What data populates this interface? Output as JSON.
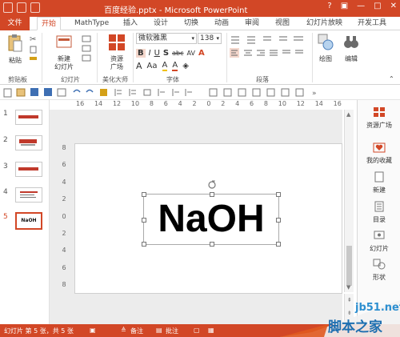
{
  "window": {
    "title": "百度经验.pptx - Microsoft PowerPoint",
    "controls": [
      "?",
      "▣",
      "—",
      "□",
      "✕"
    ]
  },
  "tabs": [
    "文件",
    "开始",
    "MathType",
    "插入",
    "设计",
    "切换",
    "动画",
    "审阅",
    "视图",
    "幻灯片放映",
    "开发工具"
  ],
  "ribbon": {
    "paste": "粘贴",
    "new_slide": "新建\n幻灯片",
    "resource_square": "资源\n广场",
    "font_name": "微软雅黑",
    "font_size": "138",
    "drawing": "绘图",
    "editing": "编辑",
    "groups": [
      "剪贴板",
      "幻灯片",
      "美化大师",
      "字体",
      "段落"
    ],
    "font_buttons": [
      "B",
      "I",
      "U",
      "S",
      "abc",
      "AV",
      "A"
    ],
    "font_row2": [
      "A",
      "Aa",
      "A",
      "A",
      "◈"
    ]
  },
  "ruler": {
    "h_ticks": [
      "16",
      "14",
      "12",
      "10",
      "8",
      "6",
      "4",
      "2",
      "0",
      "2",
      "4",
      "6",
      "8",
      "10",
      "12",
      "14",
      "16"
    ],
    "v_ticks": [
      "8",
      "6",
      "4",
      "2",
      "0",
      "2",
      "4",
      "6",
      "8"
    ]
  },
  "slides": [
    {
      "num": "1",
      "label": "百度经验"
    },
    {
      "num": "2",
      "label": "编辑表格"
    },
    {
      "num": "3",
      "label": "百度经验"
    },
    {
      "num": "4",
      "label": "Better..."
    },
    {
      "num": "5",
      "label": "NaOH"
    }
  ],
  "slide": {
    "text": "NaOH"
  },
  "right_pane": [
    "资源广场",
    "我的收藏",
    "新建",
    "目录",
    "幻灯片",
    "形状"
  ],
  "status": {
    "slide_info": "幻灯片 第 5 张，共 5 张",
    "notes": "备注",
    "comments": "批注"
  },
  "watermark": {
    "url": "jb51.net",
    "name": "脚本之家"
  }
}
